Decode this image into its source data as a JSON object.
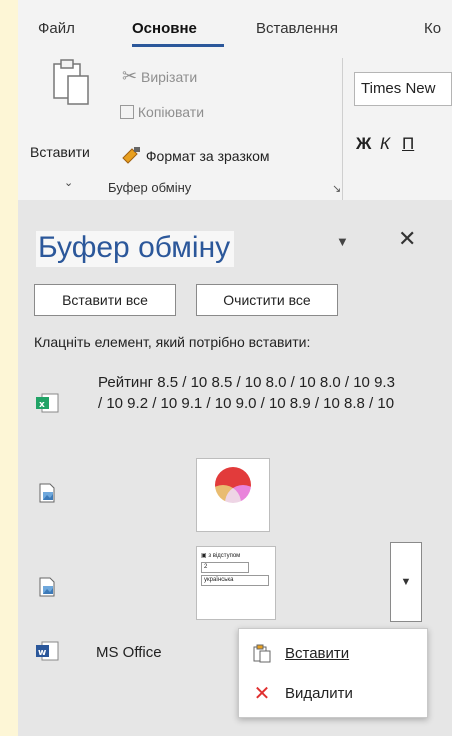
{
  "tabs": [
    {
      "label": "Файл"
    },
    {
      "label": "Основне"
    },
    {
      "label": "Вставлення"
    },
    {
      "label": "Ко"
    }
  ],
  "ribbon": {
    "paste_label": "Вставити",
    "cut_label": "Вирізати",
    "copy_label": "Копіювати",
    "format_painter_label": "Формат за зразком",
    "group_label": "Буфер обміну",
    "font_name": "Times New",
    "bold": "Ж",
    "italic": "К",
    "underline": "П"
  },
  "pane": {
    "title": "Буфер обміну",
    "paste_all": "Вставити все",
    "clear_all": "Очистити все",
    "instruction": "Клацніть елемент, який потрібно вставити:",
    "entries": [
      {
        "type": "excel",
        "icon": "excel-icon",
        "text": "Рейтинг 8.5 / 10 8.5 / 10 8.0 / 10 8.0 / 10 9.3 / 10 9.2 / 10 9.1 / 10 9.0 / 10 8.9 / 10 8.8 / 10"
      },
      {
        "type": "image",
        "icon": "picture-icon",
        "thumb": "color-circles"
      },
      {
        "type": "image",
        "icon": "picture-icon",
        "thumb": "form-snippet",
        "thumb_text": [
          "з відступом",
          "2",
          "українська"
        ]
      },
      {
        "type": "word",
        "icon": "word-icon",
        "text": "MS Office"
      }
    ]
  },
  "context_menu": {
    "paste": "Вставити",
    "delete": "Видалити"
  },
  "colors": {
    "accent": "#2b579a",
    "excel": "#21a366",
    "word": "#2b579a",
    "delete": "#e03030"
  }
}
